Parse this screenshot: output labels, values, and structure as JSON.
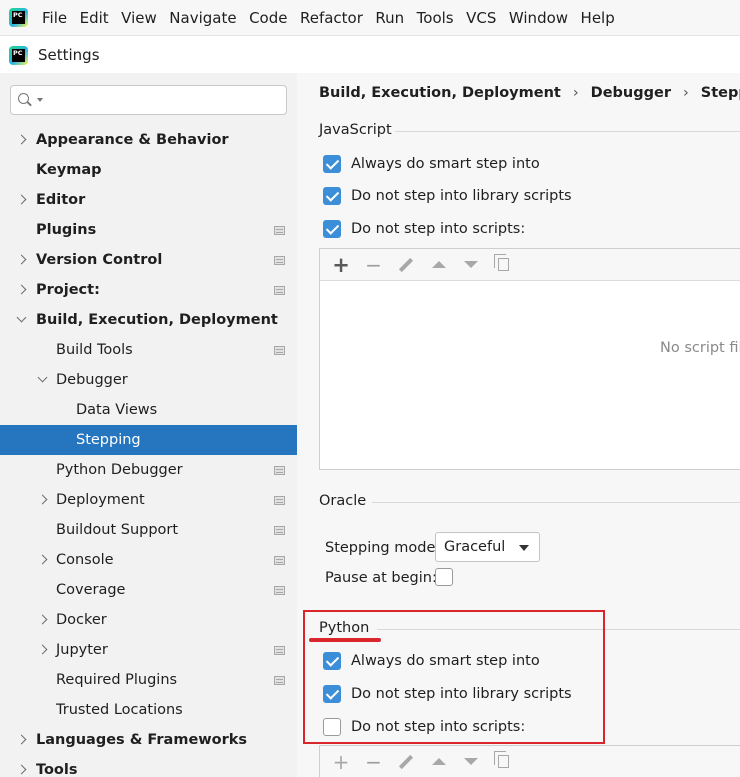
{
  "menubar": {
    "items": [
      "File",
      "Edit",
      "View",
      "Navigate",
      "Code",
      "Refactor",
      "Run",
      "Tools",
      "VCS",
      "Window",
      "Help"
    ]
  },
  "logo": {
    "text": "PC"
  },
  "window": {
    "title": "Settings"
  },
  "search": {
    "placeholder": "",
    "icon": "search-icon"
  },
  "sidebar": {
    "items": [
      {
        "label": "Appearance & Behavior",
        "arrow": "right",
        "bold": true,
        "icon": false
      },
      {
        "label": "Keymap",
        "arrow": "none",
        "bold": true,
        "icon": false
      },
      {
        "label": "Editor",
        "arrow": "right",
        "bold": true,
        "icon": false
      },
      {
        "label": "Plugins",
        "arrow": "none",
        "bold": true,
        "icon": true
      },
      {
        "label": "Version Control",
        "arrow": "right",
        "bold": true,
        "icon": true
      },
      {
        "label": "Project:",
        "arrow": "right",
        "bold": true,
        "icon": true
      },
      {
        "label": "Build, Execution, Deployment",
        "arrow": "down",
        "bold": true,
        "icon": false
      },
      {
        "label": "Build Tools",
        "arrow": "none",
        "bold": false,
        "icon": true
      },
      {
        "label": "Debugger",
        "arrow": "down",
        "bold": false,
        "icon": false
      },
      {
        "label": "Data Views",
        "arrow": "none",
        "bold": false,
        "icon": false
      },
      {
        "label": "Stepping",
        "arrow": "none",
        "bold": false,
        "icon": false,
        "selected": true
      },
      {
        "label": "Python Debugger",
        "arrow": "none",
        "bold": false,
        "icon": true
      },
      {
        "label": "Deployment",
        "arrow": "right",
        "bold": false,
        "icon": true
      },
      {
        "label": "Buildout Support",
        "arrow": "none",
        "bold": false,
        "icon": true
      },
      {
        "label": "Console",
        "arrow": "right",
        "bold": false,
        "icon": true
      },
      {
        "label": "Coverage",
        "arrow": "none",
        "bold": false,
        "icon": true
      },
      {
        "label": "Docker",
        "arrow": "right",
        "bold": false,
        "icon": false
      },
      {
        "label": "Jupyter",
        "arrow": "right",
        "bold": false,
        "icon": true
      },
      {
        "label": "Required Plugins",
        "arrow": "none",
        "bold": false,
        "icon": true
      },
      {
        "label": "Trusted Locations",
        "arrow": "none",
        "bold": false,
        "icon": false
      },
      {
        "label": "Languages & Frameworks",
        "arrow": "right",
        "bold": true,
        "icon": false
      },
      {
        "label": "Tools",
        "arrow": "right",
        "bold": true,
        "icon": false
      }
    ]
  },
  "breadcrumb": [
    "Build, Execution, Deployment",
    "Debugger",
    "Stepping"
  ],
  "javascript": {
    "title": "JavaScript",
    "options": [
      {
        "label": "Always do smart step into",
        "checked": true
      },
      {
        "label": "Do not step into library scripts",
        "checked": true
      },
      {
        "label": "Do not step into scripts:",
        "checked": true
      }
    ],
    "empty_text": "No script filt"
  },
  "oracle": {
    "title": "Oracle",
    "stepping_mode_label": "Stepping mode:",
    "stepping_mode_value": "Graceful",
    "pause_at_begin_label": "Pause at begin:",
    "pause_at_begin_checked": false
  },
  "python": {
    "title": "Python",
    "options": [
      {
        "label": "Always do smart step into",
        "checked": true
      },
      {
        "label": "Do not step into library scripts",
        "checked": true
      },
      {
        "label": "Do not step into scripts:",
        "checked": false
      }
    ]
  },
  "colors": {
    "selection": "#2675bf",
    "checkbox": "#3c8ed8",
    "annotation": "#d8262c"
  }
}
